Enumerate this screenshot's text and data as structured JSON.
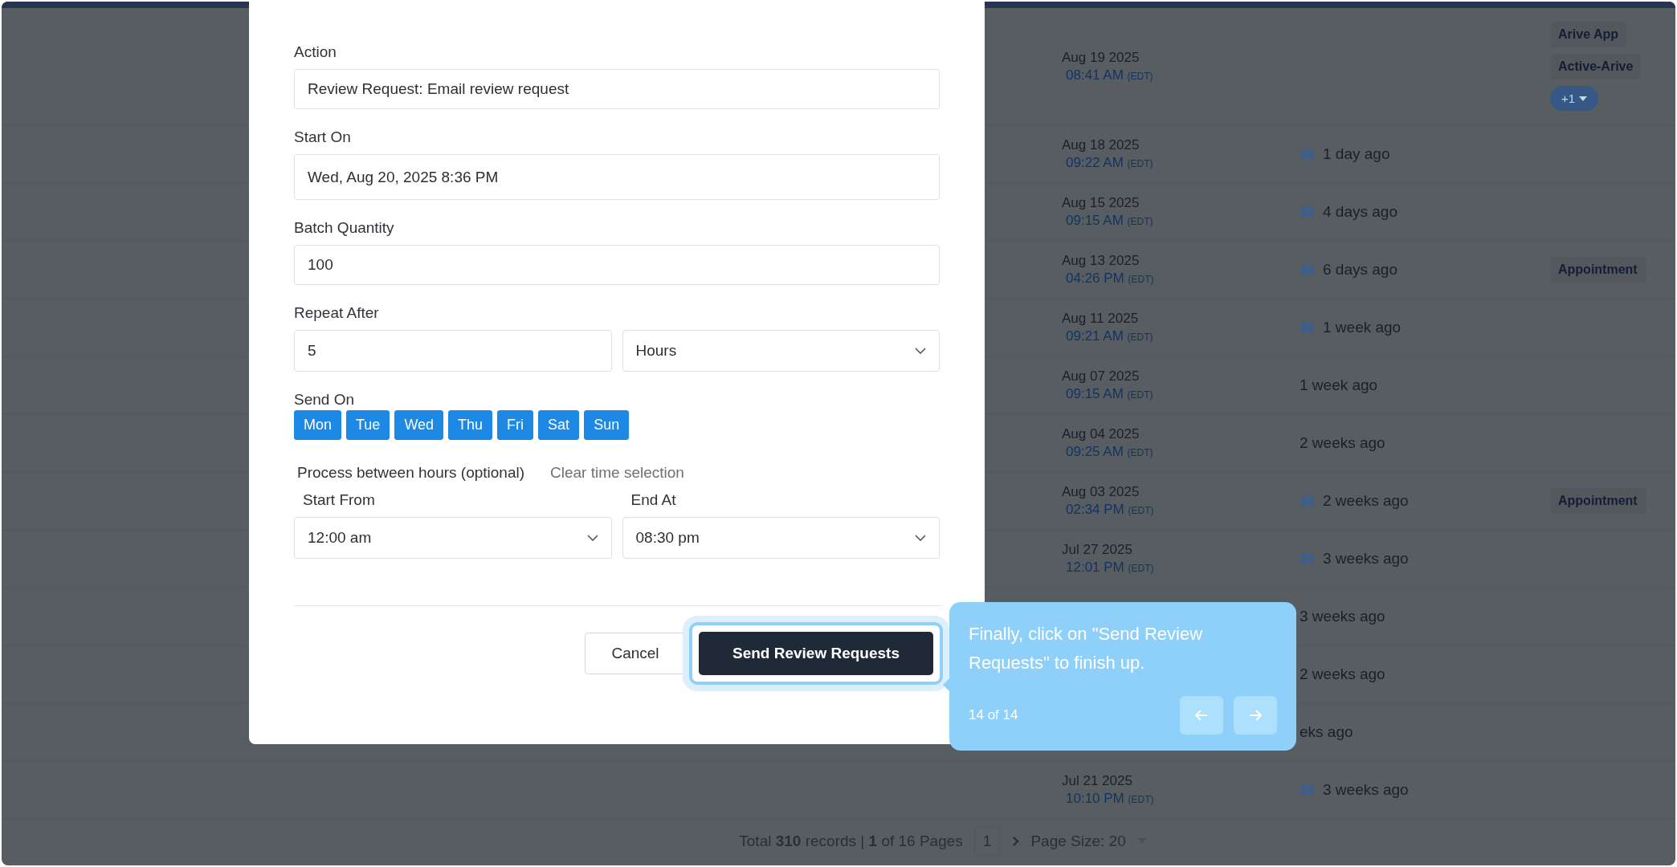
{
  "table": {
    "rows": [
      {
        "date": "Aug 19 2025",
        "time": "08:41 AM",
        "zone": "(EDT)",
        "contact": "",
        "mail": false,
        "tags": [
          "Arive App",
          "Active-Arive"
        ],
        "more": "+1"
      },
      {
        "date": "Aug 18 2025",
        "time": "09:22 AM",
        "zone": "(EDT)",
        "contact": "1 day ago",
        "mail": true,
        "tags": []
      },
      {
        "date": "Aug 15 2025",
        "time": "09:15 AM",
        "zone": "(EDT)",
        "contact": "4 days ago",
        "mail": true,
        "tags": []
      },
      {
        "date": "Aug 13 2025",
        "time": "04:26 PM",
        "zone": "(EDT)",
        "contact": "6 days ago",
        "mail": true,
        "tags": [
          "Appointment"
        ]
      },
      {
        "date": "Aug 11 2025",
        "time": "09:21 AM",
        "zone": "(EDT)",
        "contact": "1 week ago",
        "mail": true,
        "tags": []
      },
      {
        "date": "Aug 07 2025",
        "time": "09:15 AM",
        "zone": "(EDT)",
        "contact": "1 week ago",
        "mail": false,
        "tags": []
      },
      {
        "date": "Aug 04 2025",
        "time": "09:25 AM",
        "zone": "(EDT)",
        "contact": "2 weeks ago",
        "mail": false,
        "tags": []
      },
      {
        "date": "Aug 03 2025",
        "time": "02:34 PM",
        "zone": "(EDT)",
        "contact": "2 weeks ago",
        "mail": true,
        "tags": [
          "Appointment"
        ]
      },
      {
        "date": "Jul 27 2025",
        "time": "12:01 PM",
        "zone": "(EDT)",
        "contact": "3 weeks ago",
        "mail": true,
        "tags": []
      },
      {
        "contact": "3 weeks ago",
        "mail": false,
        "tags": []
      },
      {
        "contact": "2 weeks ago",
        "mail": false,
        "tags": []
      },
      {
        "contact": "eks ago",
        "mail": false,
        "tags": []
      },
      {
        "date": "Jul 21 2025",
        "time": "10:10 PM",
        "zone": "(EDT)",
        "contact": "3 weeks ago",
        "mail": true,
        "tags": []
      }
    ]
  },
  "pagination": {
    "summary": "Total **310** records | **1** of 16 Pages",
    "page": "1",
    "page_size": "Page Size: 20"
  },
  "modal": {
    "action": {
      "label": "Action",
      "value": "Review Request: Email review request"
    },
    "start_on": {
      "label": "Start On",
      "value": "Wed, Aug 20, 2025 8:36 PM"
    },
    "batch": {
      "label": "Batch Quantity",
      "value": "100"
    },
    "repeat": {
      "label": "Repeat After",
      "value": "5",
      "unit": "Hours"
    },
    "send_on": {
      "label": "Send On",
      "days": [
        {
          "label": "Mon",
          "selected": true
        },
        {
          "label": "Tue",
          "selected": true
        },
        {
          "label": "Wed",
          "selected": true
        },
        {
          "label": "Thu",
          "selected": true
        },
        {
          "label": "Fri",
          "selected": true
        },
        {
          "label": "Sat",
          "selected": true
        },
        {
          "label": "Sun",
          "selected": true
        }
      ]
    },
    "hours": {
      "label": "Process between hours (optional)",
      "clear": "Clear time selection",
      "start_label": "Start From",
      "start": "12:00 am",
      "end_label": "End At",
      "end": "08:30 pm"
    },
    "buttons": {
      "cancel": "Cancel",
      "submit": "Send Review Requests"
    }
  },
  "tour": {
    "text": "Finally, click on \"Send Review Requests\" to finish up.",
    "step": "14 of 14"
  }
}
